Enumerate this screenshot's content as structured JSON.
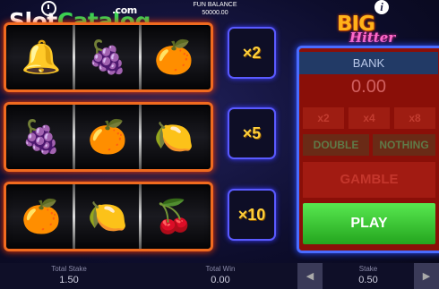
{
  "watermark": {
    "part1": "Slot",
    "part2": "Catalog",
    "suffix": ".com"
  },
  "header": {
    "balance_label": "FUN BALANCE",
    "balance_value": "50000.00",
    "info_label": "i"
  },
  "logo": {
    "line1": "BIG",
    "line2": "Hitter"
  },
  "reels": [
    {
      "symbols": [
        "🔔",
        "🍇",
        "🍊"
      ]
    },
    {
      "symbols": [
        "🍇",
        "🍊",
        "🍋"
      ]
    },
    {
      "symbols": [
        "🍊",
        "🍋",
        "🍒"
      ]
    }
  ],
  "multipliers": [
    "×2",
    "×5",
    "×10"
  ],
  "bank": {
    "title": "BANK",
    "value": "0.00",
    "x_buttons": [
      "x2",
      "x4",
      "x8"
    ],
    "double_label": "DOUBLE",
    "nothing_label": "NOTHING",
    "gamble_label": "GAMBLE",
    "play_label": "PLAY"
  },
  "footer": {
    "total_stake_label": "Total Stake",
    "total_stake_value": "1.50",
    "total_win_label": "Total Win",
    "total_win_value": "0.00",
    "stake_label": "Stake",
    "stake_value": "0.50"
  },
  "colors": {
    "reel_frame": "#f06a1f",
    "panel_frame": "#4a6cff",
    "play": "#3cc634",
    "multiplier_text": "#ffcf3a"
  }
}
